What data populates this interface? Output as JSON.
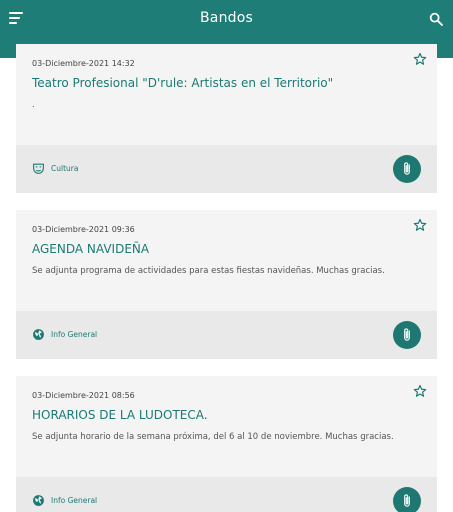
{
  "appbar": {
    "title": "Bandos",
    "menu_icon": "menu-icon",
    "search_icon": "search-icon",
    "background": "#1f7d78"
  },
  "bandos": [
    {
      "date": "03-Diciembre-2021 14:32",
      "title": "Teatro Profesional \"D'rule: Artistas en el Territorio\"",
      "body": ".",
      "category": "Cultura",
      "category_icon": "theater-masks-icon",
      "favorite_icon": "star-outline-icon",
      "attachment_icon": "paperclip-icon"
    },
    {
      "date": "03-Diciembre-2021 09:36",
      "title": "AGENDA NAVIDEÑA",
      "body": "Se adjunta programa de actividades para estas fiestas navideñas. Muchas gracias.",
      "category": "Info General",
      "category_icon": "globe-icon",
      "favorite_icon": "star-outline-icon",
      "attachment_icon": "paperclip-icon"
    },
    {
      "date": "03-Diciembre-2021 08:56",
      "title": "HORARIOS DE LA LUDOTECA.",
      "body": "Se adjunta horario de la semana próxima, del 6 al 10 de noviembre. Muchas gracias.",
      "category": "Info General",
      "category_icon": "globe-icon",
      "favorite_icon": "star-outline-icon",
      "attachment_icon": "paperclip-icon"
    }
  ],
  "colors": {
    "accent": "#1b7a73",
    "card_background": "#f4f4f4",
    "card_footer": "#e9e9e9"
  }
}
